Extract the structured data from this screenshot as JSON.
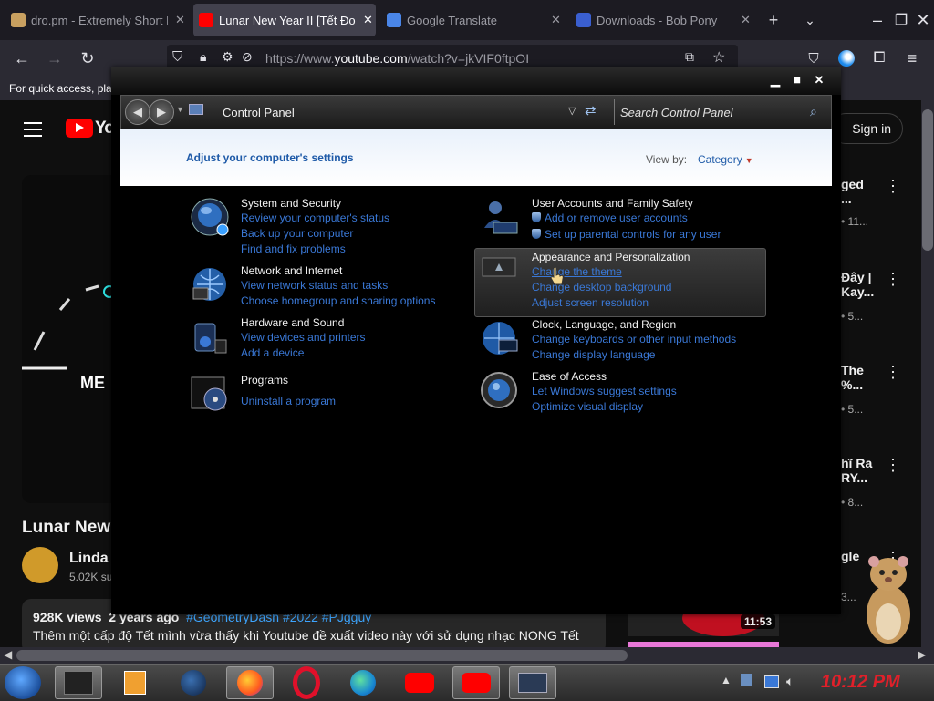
{
  "browser": {
    "tabs": [
      {
        "title": "dro.pm - Extremely Short L",
        "active": false
      },
      {
        "title": "Lunar New Year II [Tết Đon",
        "active": true
      },
      {
        "title": "Google Translate",
        "active": false
      },
      {
        "title": "Downloads - Bob Pony",
        "active": false
      }
    ],
    "url_prefix": "https://www.",
    "url_host": "youtube.com",
    "url_path": "/watch?v=jkVIF0ftpOI",
    "bookmarks_text": "For quick access, pla"
  },
  "youtube": {
    "logo": "Yo",
    "sign_in": "Sign in",
    "video_title": "Lunar New",
    "overlay_text": "ME",
    "channel_name": "Linda",
    "subscribers": "5.02K su",
    "views": "928K views",
    "age": "2 years ago",
    "tags": "#GeometryDash #2022 #PJgguy",
    "description": "Thêm một cấp độ Tết mình vừa thấy khi Youtube đề xuất video này với sử dụng nhạc NONG Tết",
    "recommendations": [
      {
        "title1": "ged",
        "title2": "...",
        "meta": "• 11..."
      },
      {
        "title1": "Đây |",
        "title2": "Kay...",
        "meta": "• 5..."
      },
      {
        "title1": "The",
        "title2": "%...",
        "meta": "• 5..."
      },
      {
        "title1": "hĩ Ra",
        "title2": "RY...",
        "meta": "• 8..."
      },
      {
        "title1": "gle",
        "title2": "",
        "meta": "3..."
      }
    ],
    "duration": "11:53"
  },
  "control_panel": {
    "address": "Control Panel",
    "search_placeholder": "Search Control Panel",
    "header": "Adjust your computer's settings",
    "view_by_label": "View by:",
    "view_by_value": "Category",
    "categories": [
      {
        "title": "System and Security",
        "icon": "system-security-icon",
        "links": [
          "Review your computer's status",
          "Back up your computer",
          "Find and fix problems"
        ]
      },
      {
        "title": "Network and Internet",
        "icon": "network-icon",
        "links": [
          "View network status and tasks",
          "Choose homegroup and sharing options"
        ]
      },
      {
        "title": "Hardware and Sound",
        "icon": "hardware-sound-icon",
        "links": [
          "View devices and printers",
          "Add a device"
        ]
      },
      {
        "title": "Programs",
        "icon": "programs-icon",
        "links": [
          "Uninstall a program"
        ]
      },
      {
        "title": "User Accounts and Family Safety",
        "icon": "user-accounts-icon",
        "links": [
          "Add or remove user accounts",
          "Set up parental controls for any user"
        ]
      },
      {
        "title": "Appearance and Personalization",
        "icon": "appearance-icon",
        "links": [
          "Change the theme",
          "Change desktop background",
          "Adjust screen resolution"
        ]
      },
      {
        "title": "Clock, Language, and Region",
        "icon": "clock-region-icon",
        "links": [
          "Change keyboards or other input methods",
          "Change display language"
        ]
      },
      {
        "title": "Ease of Access",
        "icon": "ease-of-access-icon",
        "links": [
          "Let Windows suggest settings",
          "Optimize visual display"
        ]
      }
    ]
  },
  "taskbar": {
    "clock": "10:12 PM",
    "items": [
      "start-orb-icon",
      "windows-explorer-icon",
      "media-player-icon",
      "globe-icon",
      "firefox-icon",
      "opera-icon",
      "edge-icon",
      "youtube-icon",
      "youtube-icon",
      "control-panel-icon"
    ]
  },
  "colors": {
    "link": "#3a78d6",
    "header_text": "#1e5aa8",
    "clock": "#e0202a",
    "youtube_red": "#ff0000"
  }
}
